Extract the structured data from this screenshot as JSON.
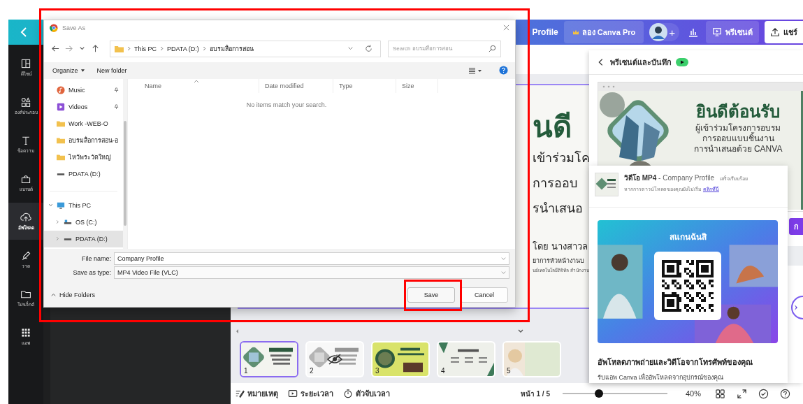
{
  "canva": {
    "topbar": {
      "title": "Profile",
      "try_pro": "ลอง Canva Pro",
      "add": "+",
      "present": "พรีเซนต์",
      "share": "แชร์"
    },
    "sidebar": [
      {
        "kind": "design",
        "label": "ดีไซน์",
        "selected": false
      },
      {
        "kind": "elements",
        "label": "องค์ประกอบ",
        "selected": false
      },
      {
        "kind": "text",
        "label": "ข้อความ",
        "selected": false
      },
      {
        "kind": "brand",
        "label": "แบรนด์",
        "selected": false
      },
      {
        "kind": "uploads",
        "label": "อัพโหลด",
        "selected": true
      },
      {
        "kind": "draw",
        "label": "วาด",
        "selected": false
      },
      {
        "kind": "projects",
        "label": "โปรเจ็กต์",
        "selected": false
      },
      {
        "kind": "apps",
        "label": "แอพ",
        "selected": false
      }
    ],
    "slide": {
      "heading": "นดี",
      "lines": [
        "เข้าร่วมโค",
        "การออบ",
        "รนำเสนอ"
      ],
      "byline": "โดย นางสาวล",
      "role": "ยาการหัวหน้างานบ",
      "org": "นย์เทคโนโลยีดิจิทัล สำนักงาน"
    },
    "thumbnails": [
      {
        "number": "1",
        "kind": "welcome",
        "selected": true,
        "hidden": false
      },
      {
        "number": "2",
        "kind": "welcome",
        "selected": false,
        "hidden": true
      },
      {
        "number": "3",
        "kind": "yellow",
        "selected": false,
        "hidden": false
      },
      {
        "number": "4",
        "kind": "history",
        "selected": false,
        "hidden": false
      },
      {
        "number": "5",
        "selected": false,
        "hidden": false
      }
    ],
    "footer": {
      "notes": "หมายเหตุ",
      "duration": "ระยะเวลา",
      "timer": "ตัวจับเวลา",
      "page": "หน้า 1 / 5",
      "zoom": {
        "level": 0.35
      },
      "zoom_reading": "40%"
    }
  },
  "present_panel": {
    "title": "พรีเซนต์และบันทึก",
    "preview": {
      "heading": "ยินดีต้อนรับ",
      "lines": [
        "ผู้เข้าร่วมโครงการอบรม",
        "การออบแบบชิ้นงาน",
        "การนำเสนอด้วย CANVA"
      ]
    },
    "download": {
      "title": "**วิดีโอ MP4** - Company Profile",
      "status": "เสร็จเรียบร้อย",
      "hint": "หากการดาวน์โหลดของคุณยังไม่เริ่ม",
      "link": "คลิกที่นี่"
    },
    "qr_card": {
      "title": "สแกนฉันสิ",
      "heading": "อัพโหลดภาพถ่ายและวิดีโอจากโทรศัพท์ของคุณ",
      "subtext": "รับแอพ Canva เพื่ออัพโหลดจากอุปกรณ์ของคุณ"
    },
    "side_button": "ก"
  },
  "save_dialog": {
    "title": "Save As",
    "path": [
      "This PC",
      "PDATA (D:)",
      "อบรมสื่อการสอน"
    ],
    "search": {
      "placeholder": "Search อบรมสื่อการสอน"
    },
    "toolbar": {
      "organize": "Organize",
      "new_folder": "New folder"
    },
    "quick_access": [
      {
        "kind": "music",
        "label": "Music",
        "pinned": true,
        "selected": false
      },
      {
        "kind": "videos",
        "label": "Videos",
        "pinned": true,
        "selected": false
      },
      {
        "kind": "folder",
        "label": "Work -WEB-O",
        "pinned": false,
        "selected": false
      },
      {
        "kind": "folder",
        "label": "อบรมสื่อการสอน-อ",
        "pinned": false,
        "selected": false
      },
      {
        "kind": "folder",
        "label": "ไหว้พระวัดใหญ่",
        "pinned": false,
        "selected": false
      },
      {
        "kind": "drive",
        "label": "PDATA (D:)",
        "pinned": false,
        "selected": false
      }
    ],
    "tree": [
      {
        "kind": "pc",
        "label": "This PC",
        "expanded": true,
        "selected": false,
        "children": [
          {
            "kind": "os",
            "label": "OS (C:)",
            "expanded": false,
            "selected": false
          },
          {
            "kind": "drive",
            "label": "PDATA (D:)",
            "expanded": false,
            "selected": true
          }
        ]
      }
    ],
    "columns": [
      {
        "label": "Name",
        "sorted": true
      },
      {
        "label": "Date modified",
        "sorted": false
      },
      {
        "label": "Type",
        "sorted": false
      },
      {
        "label": "Size",
        "sorted": false
      }
    ],
    "empty_message": "No items match your search.",
    "file_name": {
      "label": "File name:",
      "value": "Company Profile"
    },
    "save_type": {
      "label": "Save as type:",
      "value": "MP4 Video File (VLC)"
    },
    "hide_folders": "Hide Folders",
    "buttons": [
      {
        "kind": "primary",
        "label": "Save"
      },
      {
        "kind": "secondary",
        "label": "Cancel"
      }
    ]
  }
}
